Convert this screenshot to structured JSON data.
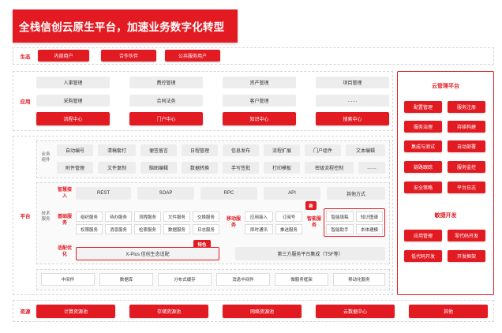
{
  "title": "全栈信创云原生平台，加速业务数字化转型",
  "rows": {
    "ecosystem": "生态",
    "application": "应用",
    "platform": "平台",
    "resource": "资源"
  },
  "ecosystem_items": [
    "内部用户",
    "合作伙伴",
    "公共服务用户"
  ],
  "app_gray": [
    [
      "人事管理",
      "费控管理",
      "资产管理",
      "项目管理"
    ],
    [
      "采购管理",
      "合同法务",
      "客户管理",
      "……"
    ]
  ],
  "app_red": [
    "流程中心",
    "门户中心",
    "知识中心",
    "搜索中心"
  ],
  "business_label": "业务组件",
  "business_items": [
    [
      "自动编号",
      "清稿套打",
      "便签留言",
      "日程管理",
      "信息发布",
      "流程扩展",
      "门户组件",
      "文本编辑"
    ],
    [
      "附件管理",
      "文件复制",
      "脑图编辑",
      "数据转换",
      "手写签批",
      "打印模板",
      "密级流程控制",
      "……"
    ]
  ],
  "tech_label": "技术服务",
  "smart_access_label": "智慧接入",
  "access_items": [
    "REST",
    "SOAP",
    "RPC",
    "API",
    "其他方式"
  ],
  "base_label": "基础服务",
  "base_items": [
    [
      "组织服务",
      "待办服务",
      "流程服务",
      "文件服务",
      "交换服务"
    ],
    [
      "权限服务",
      "消息服务",
      "检索服务",
      "数据服务",
      "日志服务"
    ]
  ],
  "mobile_label": "移动服务",
  "mobile_items": [
    [
      "应用接入",
      "订阅号"
    ],
    [
      "即时通讯",
      "推送服务"
    ]
  ],
  "new_tag": "新",
  "smart_label": "智能服务",
  "smart_items": [
    [
      "智能填稿",
      "知识图谱"
    ],
    [
      "智能助手",
      "本体建模"
    ]
  ],
  "adapt_label": "适配优化",
  "special_tag": "特色",
  "adapt_items": [
    "X-Plus 信创生态适配",
    "第三方服务平台集成（TSF等）"
  ],
  "infra_items": [
    "中间件",
    "数据库",
    "分布式缓存",
    "消息中间件",
    "微服务框架",
    "移动化服务"
  ],
  "resource_items": [
    "计算资源池",
    "存储资源池",
    "网络资源池",
    "云数据中心",
    "其他"
  ],
  "cloud_panel": {
    "title": "云管理平台",
    "items": [
      [
        "配置管理",
        "服务注册"
      ],
      [
        "服务治理",
        "持续构建"
      ],
      [
        "集成与测试",
        "自动部署"
      ],
      [
        "链路跟踪",
        "服务监控"
      ],
      [
        "安全策略",
        "平台日志"
      ]
    ]
  },
  "agile_panel": {
    "title": "敏捷开发",
    "items": [
      [
        "应用管理",
        "零代码开发"
      ],
      [
        "低代码开发",
        "开发框架"
      ]
    ]
  },
  "colors": {
    "accent": "#e21b23",
    "gray": "#ededed"
  }
}
